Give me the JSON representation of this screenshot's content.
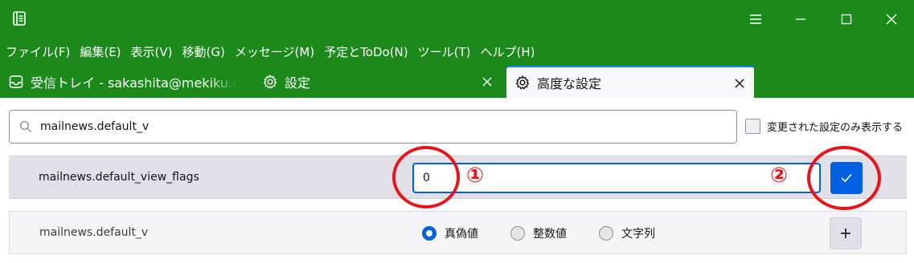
{
  "window": {
    "title_icon": "address-book-icon",
    "controls": [
      "menu-icon",
      "minimize-icon",
      "maximize-icon",
      "close-icon"
    ]
  },
  "menubar": {
    "items": [
      "ファイル(F)",
      "編集(E)",
      "表示(V)",
      "移動(G)",
      "メッセージ(M)",
      "予定とToDo(N)",
      "ツール(T)",
      "ヘルプ(H)"
    ]
  },
  "tabs": [
    {
      "label": "受信トレイ - sakashita@mekiku.com",
      "icon": "inbox-icon",
      "active": false
    },
    {
      "label": "設定",
      "icon": "gear-icon",
      "active": false
    },
    {
      "label": "高度な設定",
      "icon": "gear-icon",
      "active": true
    }
  ],
  "search": {
    "value": "mailnews.default_v",
    "placeholder": ""
  },
  "filter": {
    "label": "変更された設定のみ表示する",
    "checked": false
  },
  "prefs": [
    {
      "name": "mailnews.default_view_flags",
      "edit_value": "0",
      "action": "save",
      "action_icon": "checkmark-icon"
    },
    {
      "name": "mailnews.default_v",
      "types": [
        "真偽値",
        "整数値",
        "文字列"
      ],
      "selected_type": "真偽値",
      "action": "add",
      "action_icon": "plus-icon"
    }
  ],
  "annotations": {
    "marks": [
      "①",
      "②"
    ],
    "color": "#e8141c"
  },
  "colors": {
    "chrome_green": "#1b8a1b",
    "accent_blue": "#0061e0",
    "annotation_red": "#e8141c"
  }
}
